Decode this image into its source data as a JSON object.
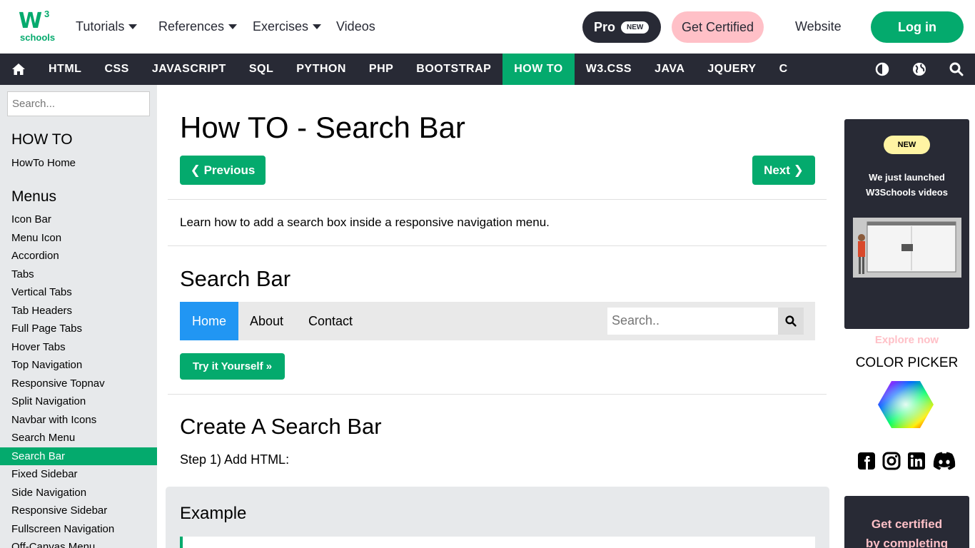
{
  "header": {
    "logo_main": "W",
    "logo_sup": "3",
    "logo_sub": "schools",
    "menus": [
      "Tutorials",
      "References",
      "Exercises",
      "Videos"
    ],
    "pro_label": "Pro",
    "pro_badge": "NEW",
    "cert_label": "Get Certified",
    "website_label": "Website",
    "login_label": "Log in"
  },
  "navbar": {
    "items": [
      "HTML",
      "CSS",
      "JAVASCRIPT",
      "SQL",
      "PYTHON",
      "PHP",
      "BOOTSTRAP",
      "HOW TO",
      "W3.CSS",
      "JAVA",
      "JQUERY",
      "C"
    ],
    "active": "HOW TO"
  },
  "sidebar": {
    "search_placeholder": "Search...",
    "heading1": "HOW TO",
    "home_link": "HowTo Home",
    "heading2": "Menus",
    "items": [
      "Icon Bar",
      "Menu Icon",
      "Accordion",
      "Tabs",
      "Vertical Tabs",
      "Tab Headers",
      "Full Page Tabs",
      "Hover Tabs",
      "Top Navigation",
      "Responsive Topnav",
      "Split Navigation",
      "Navbar with Icons",
      "Search Menu",
      "Search Bar",
      "Fixed Sidebar",
      "Side Navigation",
      "Responsive Sidebar",
      "Fullscreen Navigation",
      "Off-Canvas Menu"
    ],
    "active": "Search Bar"
  },
  "main": {
    "title": "How TO - Search Bar",
    "prev_label": "❮ Previous",
    "next_label": "Next ❯",
    "intro": "Learn how to add a search box inside a responsive navigation menu.",
    "section1": "Search Bar",
    "demo_links": [
      "Home",
      "About",
      "Contact"
    ],
    "demo_placeholder": "Search..",
    "try_label": "Try it Yourself »",
    "section2": "Create A Search Bar",
    "step1": "Step 1) Add HTML:",
    "example_title": "Example"
  },
  "right": {
    "ad_badge": "NEW",
    "ad_line1": "We just launched",
    "ad_line2": "W3Schools videos",
    "ad_cta": "Explore now",
    "color_picker": "COLOR PICKER",
    "cert_line1": "Get certified",
    "cert_line2": "by completing"
  },
  "colors": {
    "brand_green": "#04AA6D",
    "dark": "#282A35",
    "pink": "#FFC0C7",
    "demo_blue": "#2196F3"
  }
}
